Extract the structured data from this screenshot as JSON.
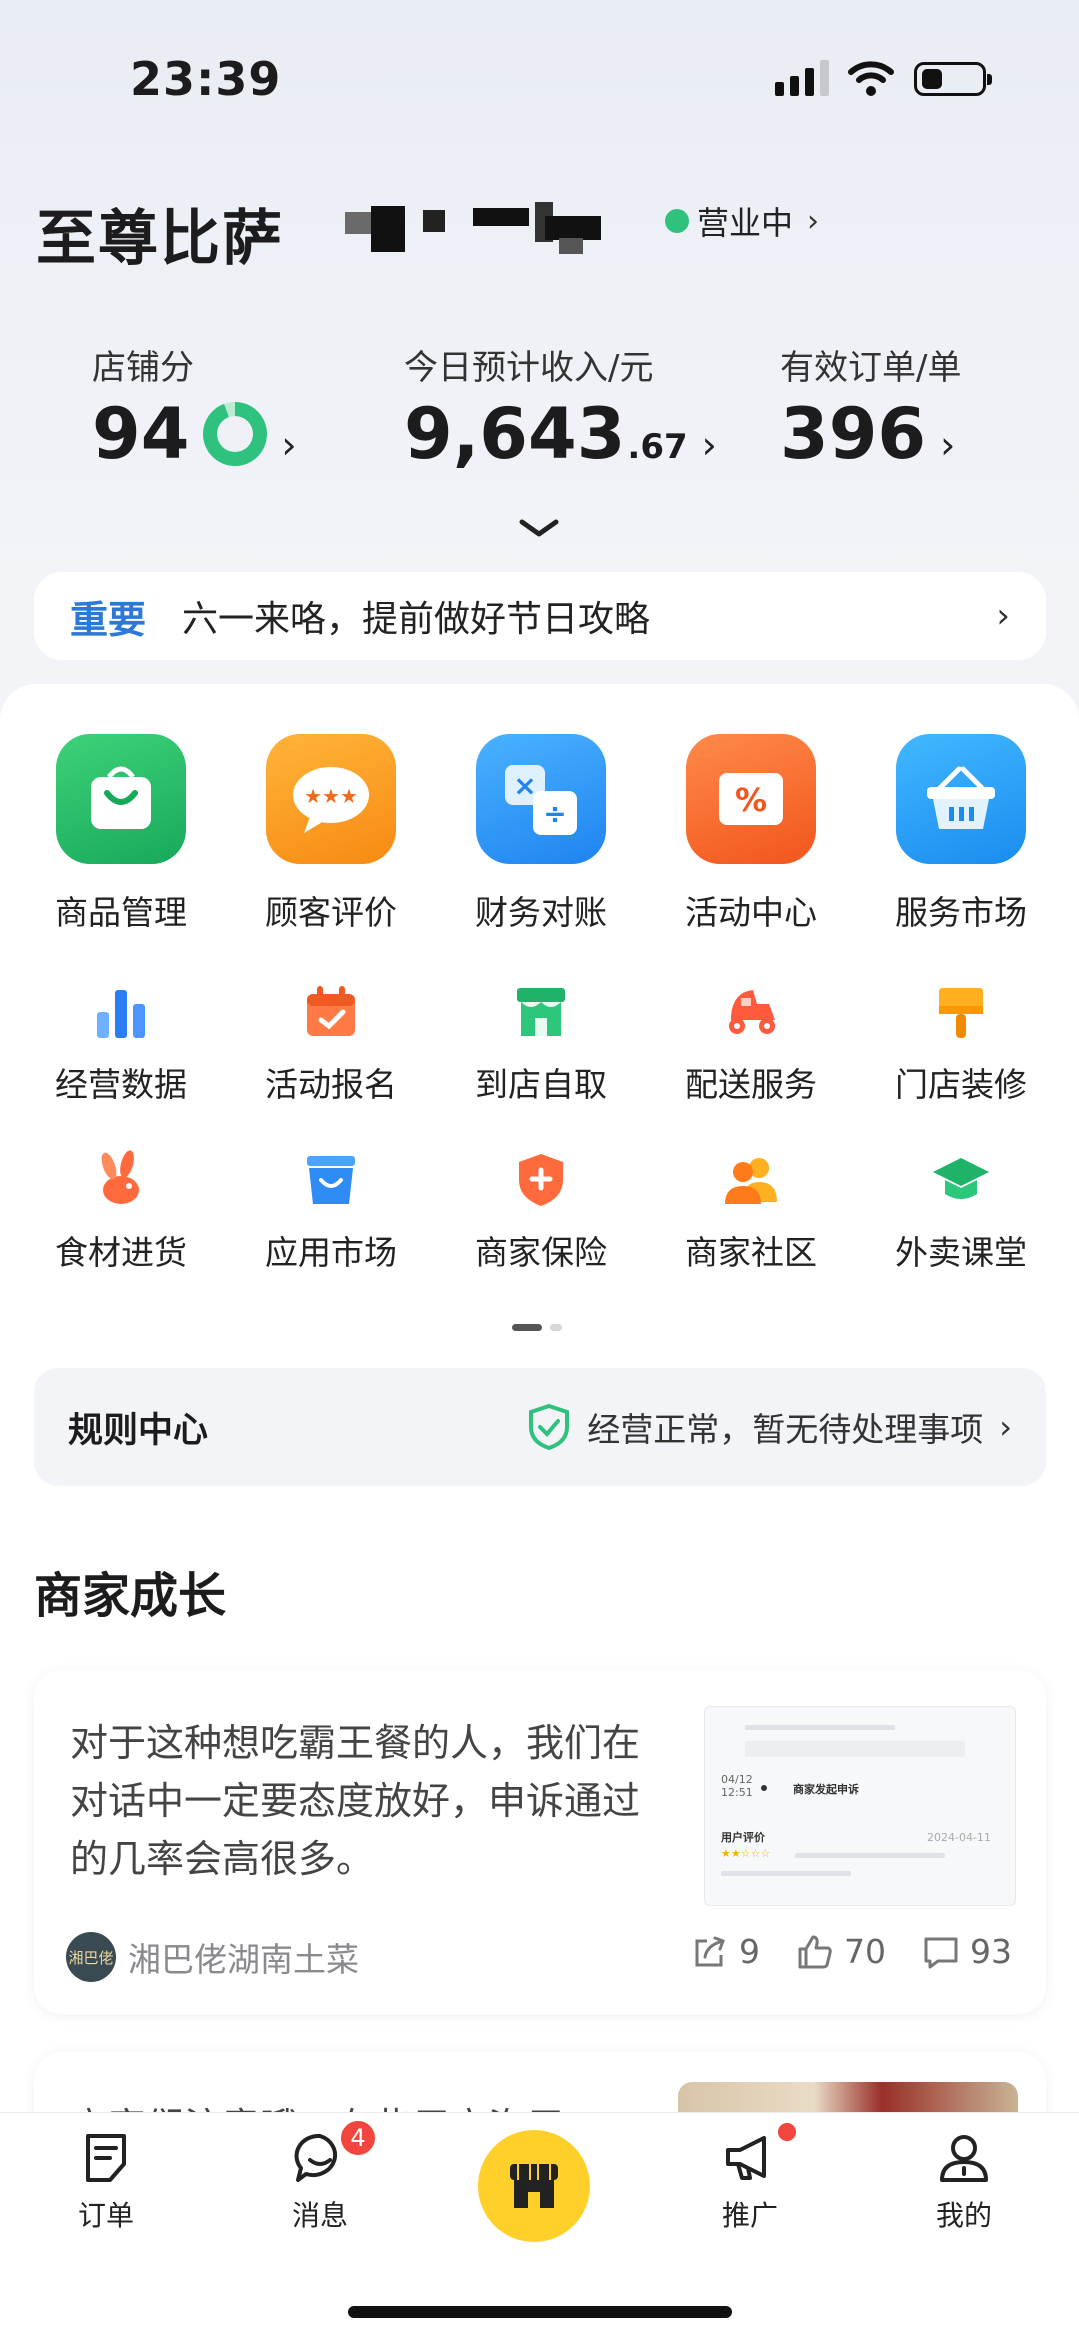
{
  "status_bar": {
    "time": "23:39"
  },
  "header": {
    "shop_name": "至尊比萨",
    "status": "营业中"
  },
  "stats": [
    {
      "label": "店铺分",
      "value": "94"
    },
    {
      "label": "今日预计收入/元",
      "value": "9,643",
      "decimal": ".67"
    },
    {
      "label": "有效订单/单",
      "value": "396"
    }
  ],
  "notice": {
    "tag": "重要",
    "text": "六一来咯，提前做好节日攻略"
  },
  "primary_grid": [
    {
      "label": "商品管理",
      "icon": "shopping-bag-icon"
    },
    {
      "label": "顾客评价",
      "icon": "review-bubble-icon"
    },
    {
      "label": "财务对账",
      "icon": "finance-calculator-icon"
    },
    {
      "label": "活动中心",
      "icon": "discount-coupon-icon"
    },
    {
      "label": "服务市场",
      "icon": "basket-icon"
    }
  ],
  "secondary_grid_row1": [
    {
      "label": "经营数据",
      "icon": "bar-chart-icon"
    },
    {
      "label": "活动报名",
      "icon": "calendar-check-icon"
    },
    {
      "label": "到店自取",
      "icon": "storefront-icon"
    },
    {
      "label": "配送服务",
      "icon": "delivery-scooter-icon"
    },
    {
      "label": "门店装修",
      "icon": "paint-brush-icon"
    }
  ],
  "secondary_grid_row2": [
    {
      "label": "食材进货",
      "icon": "rabbit-icon"
    },
    {
      "label": "应用市场",
      "icon": "app-store-bag-icon"
    },
    {
      "label": "商家保险",
      "icon": "shield-plus-icon"
    },
    {
      "label": "商家社区",
      "icon": "community-people-icon"
    },
    {
      "label": "外卖课堂",
      "icon": "graduation-cap-icon"
    }
  ],
  "rules": {
    "title": "规则中心",
    "status": "经营正常，暂无待处理事项"
  },
  "growth_section": {
    "title": "商家成长"
  },
  "articles": [
    {
      "text": "对于这种想吃霸王餐的人，我们在对话中一定要态度放好，申诉通过的几率会高很多。",
      "author": "湘巴佬湖南土菜",
      "avatar_text": "湘巴佬",
      "shares": "9",
      "likes": "70",
      "comments": "93",
      "thumb_time": "04/12\n12:51",
      "thumb_appeal": "商家发起申诉",
      "thumb_review": "用户评价",
      "thumb_date": "2024-04-11"
    },
    {
      "text": "商家们注意哦，有些用户咨用"
    }
  ],
  "tabbar": [
    {
      "label": "订单",
      "icon": "order-list-icon"
    },
    {
      "label": "消息",
      "icon": "message-bubble-icon",
      "badge": "4"
    },
    {
      "label": "",
      "icon": "store-home-icon"
    },
    {
      "label": "推广",
      "icon": "megaphone-icon"
    },
    {
      "label": "我的",
      "icon": "profile-icon"
    }
  ],
  "colors": {
    "brand_yellow": "#ffd02a",
    "open_green": "#2ec27e",
    "notice_blue": "#2b78d6",
    "badge_red": "#f2453d"
  }
}
